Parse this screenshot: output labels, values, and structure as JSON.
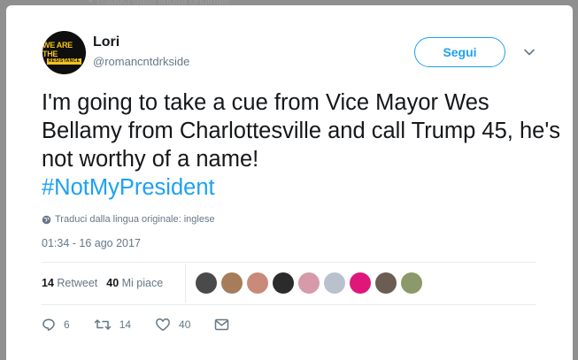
{
  "tweet": {
    "author_name": "Lori",
    "author_handle": "@romancntdrkside",
    "avatar_line1": "WE ARE THE",
    "avatar_line2": "RESISTANCE",
    "follow_label": "Segui",
    "text": "I'm going to take a cue from Vice Mayor Wes Bellamy from Charlottesville and call Trump 45, he's not worthy of a name!",
    "hashtag": "#NotMyPresident",
    "translate_label": "Traduci dalla lingua originale: inglese",
    "timestamp": "01:34 - 16 ago 2017"
  },
  "stats": {
    "retweets_count": "14",
    "retweets_label": "Retweet",
    "likes_count": "40",
    "likes_label": "Mi piace"
  },
  "likers": [
    {
      "name": "liker-1",
      "color": "#4a4a4a"
    },
    {
      "name": "liker-2",
      "color": "#a67c5b"
    },
    {
      "name": "liker-3",
      "color": "#c98a7a"
    },
    {
      "name": "liker-4",
      "color": "#2b2b2b"
    },
    {
      "name": "liker-5",
      "color": "#d79aa8"
    },
    {
      "name": "liker-6",
      "color": "#b9c2cc"
    },
    {
      "name": "liker-7",
      "color": "#e0177a"
    },
    {
      "name": "liker-8",
      "color": "#6b5d52"
    },
    {
      "name": "liker-9",
      "color": "#8c9a6b"
    }
  ],
  "actions": {
    "reply_count": "6",
    "retweet_count": "14",
    "like_count": "40"
  },
  "colors": {
    "accent": "#1da1f2",
    "text": "#14171a",
    "secondary": "#657786"
  }
}
